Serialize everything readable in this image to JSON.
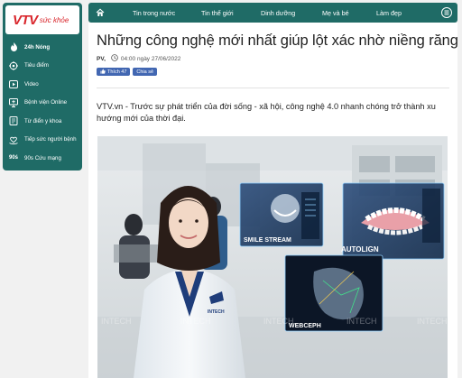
{
  "logo": {
    "brand": "VTV",
    "sub": "sức khỏe"
  },
  "sidebar": {
    "items": [
      {
        "label": "24h Nóng",
        "icon": "flame-icon"
      },
      {
        "label": "Tiêu điểm",
        "icon": "target-icon"
      },
      {
        "label": "Video",
        "icon": "video-icon"
      },
      {
        "label": "Bệnh viện Online",
        "icon": "monitor-icon"
      },
      {
        "label": "Từ điển y khoa",
        "icon": "book-icon"
      },
      {
        "label": "Tiếp sức người bệnh",
        "icon": "heart-hands-icon"
      },
      {
        "label": "90s Cứu mạng",
        "icon": "90s-icon"
      }
    ]
  },
  "nav": {
    "items": [
      "Tin trong nước",
      "Tin thế giới",
      "Dinh dưỡng",
      "Mẹ và bé",
      "Làm đẹp"
    ]
  },
  "article": {
    "title": "Những công nghệ mới nhất giúp lột xác nhờ niềng răng",
    "author": "PV,",
    "time": "04:00 ngày 27/06/2022",
    "like_label": "Thích 47",
    "share_label": "Chia sẻ",
    "lead": "VTV.vn - Trước sự phát triển của đời sống - xã hội, công nghệ 4.0 nhanh chóng trở thành xu hướng mới của thời đại."
  },
  "hero": {
    "labels": [
      "SMILE STREAM",
      "AUTOLIGN",
      "WEBCEPH"
    ],
    "coat_text": "INTECH",
    "watermark": "INTECH"
  },
  "colors": {
    "teal": "#1f6b66",
    "red": "#d9262c",
    "facebook": "#4267b2"
  }
}
